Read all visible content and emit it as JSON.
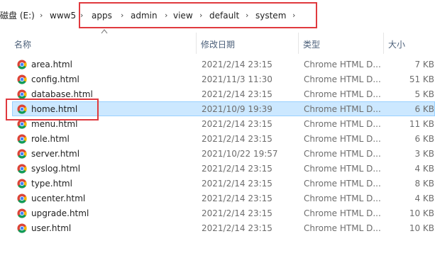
{
  "breadcrumb": {
    "items": [
      "磁盘 (E:)",
      "www5",
      "apps",
      "admin",
      "view",
      "default",
      "system"
    ]
  },
  "columns": {
    "name": "名称",
    "date": "修改日期",
    "type": "类型",
    "size": "大小"
  },
  "files": [
    {
      "name": "area.html",
      "date": "2021/2/14 23:15",
      "type": "Chrome HTML D...",
      "size": "7 KB"
    },
    {
      "name": "config.html",
      "date": "2021/11/3 11:30",
      "type": "Chrome HTML D...",
      "size": "51 KB"
    },
    {
      "name": "database.html",
      "date": "2021/2/14 23:15",
      "type": "Chrome HTML D...",
      "size": "5 KB"
    },
    {
      "name": "home.html",
      "date": "2021/10/9 19:39",
      "type": "Chrome HTML D...",
      "size": "6 KB",
      "selected": true
    },
    {
      "name": "menu.html",
      "date": "2021/2/14 23:15",
      "type": "Chrome HTML D...",
      "size": "11 KB"
    },
    {
      "name": "role.html",
      "date": "2021/2/14 23:15",
      "type": "Chrome HTML D...",
      "size": "6 KB"
    },
    {
      "name": "server.html",
      "date": "2021/10/22 19:57",
      "type": "Chrome HTML D...",
      "size": "3 KB"
    },
    {
      "name": "syslog.html",
      "date": "2021/2/14 23:15",
      "type": "Chrome HTML D...",
      "size": "4 KB"
    },
    {
      "name": "type.html",
      "date": "2021/2/14 23:15",
      "type": "Chrome HTML D...",
      "size": "8 KB"
    },
    {
      "name": "ucenter.html",
      "date": "2021/2/14 23:15",
      "type": "Chrome HTML D...",
      "size": "4 KB"
    },
    {
      "name": "upgrade.html",
      "date": "2021/2/14 23:15",
      "type": "Chrome HTML D...",
      "size": "10 KB"
    },
    {
      "name": "user.html",
      "date": "2021/2/14 23:15",
      "type": "Chrome HTML D...",
      "size": "10 KB"
    }
  ],
  "file_icon": "chrome-icon",
  "colors": {
    "highlight_border": "#e0393e",
    "selection_bg": "#cce8ff",
    "selection_border": "#99d1ff"
  }
}
